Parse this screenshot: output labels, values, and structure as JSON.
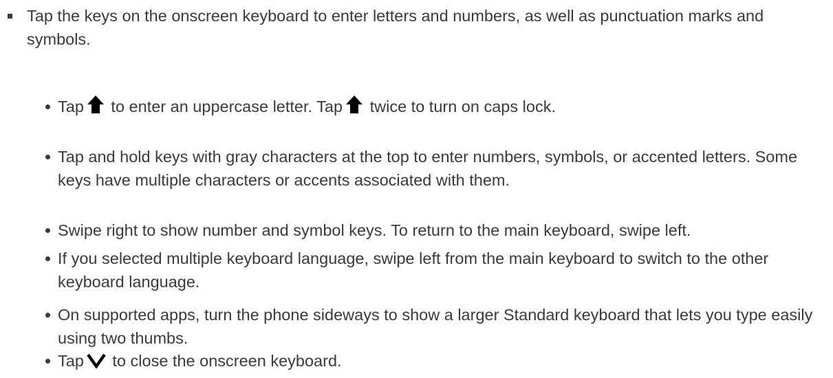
{
  "main_item": {
    "text": "Tap the keys on the onscreen keyboard to enter letters and numbers, as well as punctuation marks and symbols."
  },
  "sub_items": [
    {
      "part1": "Tap",
      "icon1": "shift-up-arrow-icon",
      "part2": "to enter an uppercase letter. Tap",
      "icon2": "shift-up-arrow-icon",
      "part3": "twice to turn on caps lock."
    },
    {
      "text": "Tap and hold keys with gray characters at the top to enter numbers, symbols, or accented letters. Some keys have multiple characters or accents associated with them."
    },
    {
      "text": "Swipe right to show number and symbol keys. To return to the main keyboard, swipe left."
    },
    {
      "text": "If you selected multiple keyboard language, swipe left from the main keyboard to switch to the other keyboard language."
    },
    {
      "text": "On supported apps, turn the phone sideways to show a larger Standard keyboard that lets you type easily using two thumbs."
    },
    {
      "part1": "Tap",
      "icon1": "chevron-down-icon",
      "part2": "to close the onscreen keyboard."
    }
  ]
}
